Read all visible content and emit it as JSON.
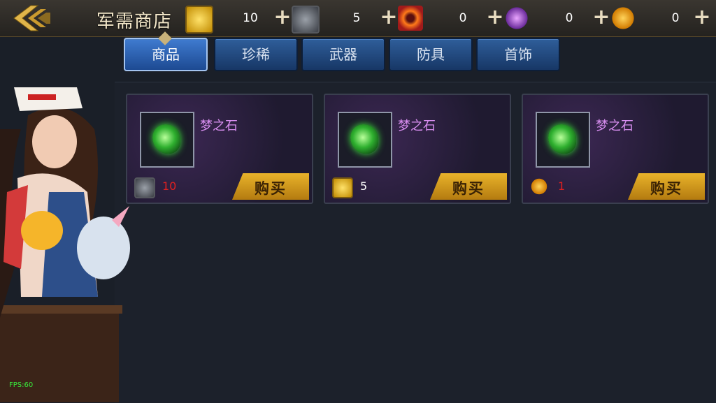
{
  "header": {
    "title": "军需商店",
    "currencies": [
      {
        "icon": "gold-cube-icon",
        "value": "10",
        "plus": "+"
      },
      {
        "icon": "silver-cube-icon",
        "value": "5",
        "plus": "+"
      },
      {
        "icon": "fire-ring-icon",
        "value": "0",
        "plus": "+"
      },
      {
        "icon": "purple-orb-icon",
        "value": "0",
        "plus": "+"
      },
      {
        "icon": "amber-gem-icon",
        "value": "0",
        "plus": "+"
      }
    ]
  },
  "tabs": [
    {
      "label": "商品",
      "active": true
    },
    {
      "label": "珍稀",
      "active": false
    },
    {
      "label": "武器",
      "active": false
    },
    {
      "label": "防具",
      "active": false
    },
    {
      "label": "首饰",
      "active": false
    }
  ],
  "items": [
    {
      "name": "梦之石",
      "price": "10",
      "currency_icon": "silver-cube-icon",
      "price_color": "#e02020",
      "buy_label": "购买"
    },
    {
      "name": "梦之石",
      "price": "5",
      "currency_icon": "gold-cube-icon",
      "price_color": "#ffffff",
      "buy_label": "购买"
    },
    {
      "name": "梦之石",
      "price": "1",
      "currency_icon": "amber-gem-icon",
      "price_color": "#e02020",
      "buy_label": "购买"
    }
  ],
  "fps": "FPS:60",
  "colors": {
    "accent_gold": "#e9b32a",
    "tab_blue": "#2f5e9a",
    "item_name": "#d88ef0"
  }
}
